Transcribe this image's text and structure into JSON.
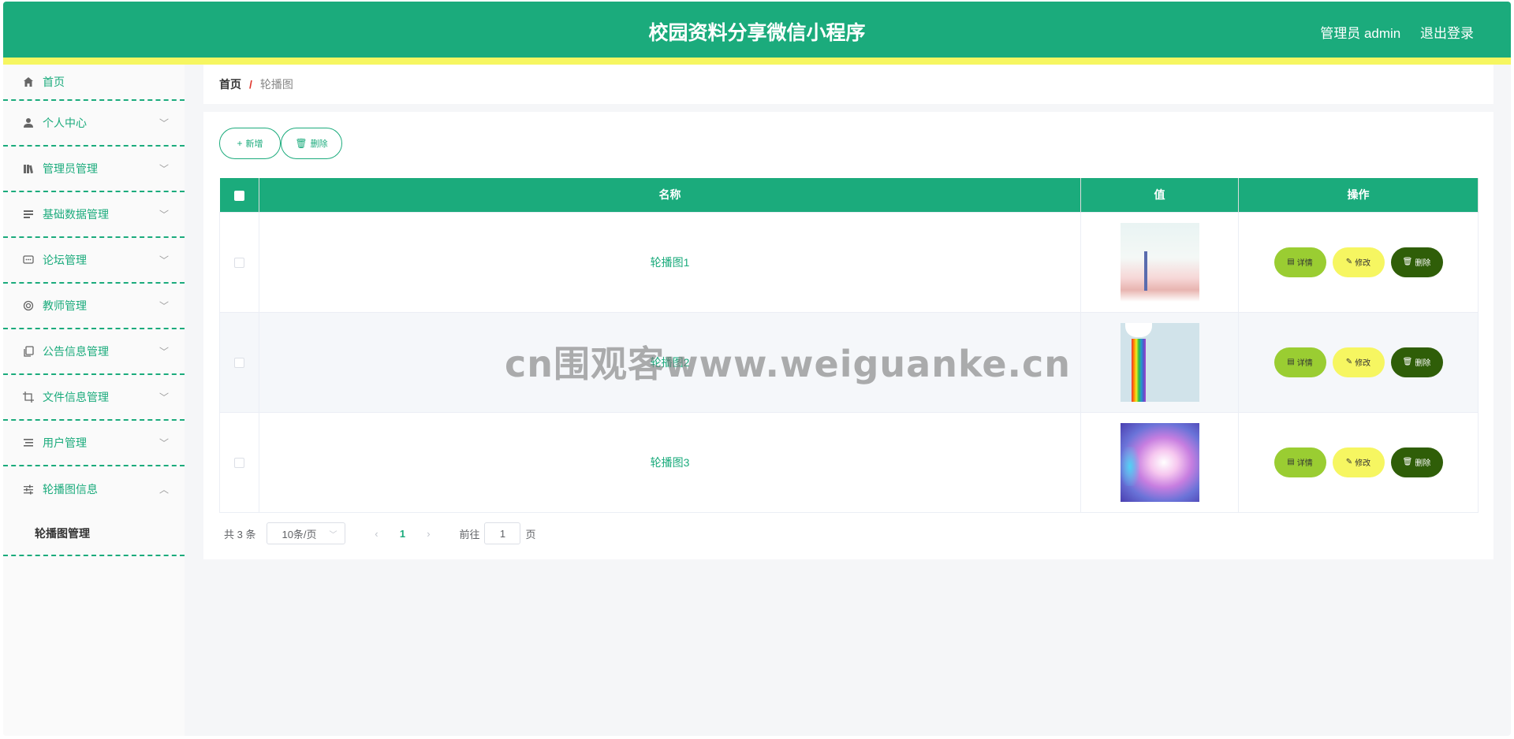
{
  "header": {
    "title": "校园资料分享微信小程序",
    "user_label": "管理员 admin",
    "logout_label": "退出登录"
  },
  "sidebar": {
    "items": [
      {
        "label": "首页",
        "icon": "home-icon"
      },
      {
        "label": "个人中心",
        "icon": "user-icon"
      },
      {
        "label": "管理员管理",
        "icon": "books-icon"
      },
      {
        "label": "基础数据管理",
        "icon": "list-icon"
      },
      {
        "label": "论坛管理",
        "icon": "chat-icon"
      },
      {
        "label": "教师管理",
        "icon": "lifebuoy-icon"
      },
      {
        "label": "公告信息管理",
        "icon": "copy-icon"
      },
      {
        "label": "文件信息管理",
        "icon": "crop-icon"
      },
      {
        "label": "用户管理",
        "icon": "menu-icon"
      },
      {
        "label": "轮播图信息",
        "icon": "sliders-icon"
      }
    ],
    "submenu_label": "轮播图管理"
  },
  "breadcrumb": {
    "home": "首页",
    "separator": "/",
    "current": "轮播图"
  },
  "toolbar": {
    "add_label": "新增",
    "delete_label": "删除"
  },
  "table": {
    "headers": [
      "名称",
      "值",
      "操作"
    ],
    "rows": [
      {
        "name": "轮播图1",
        "image": "illustration-girl-with-fence"
      },
      {
        "name": "轮播图2",
        "image": "rainbow-sky"
      },
      {
        "name": "轮播图3",
        "image": "purple-gradient-glow"
      }
    ],
    "actions": {
      "detail": "详情",
      "edit": "修改",
      "delete": "删除"
    }
  },
  "pagination": {
    "total": "共 3 条",
    "page_size": "10条/页",
    "current_page": "1",
    "goto_prefix": "前往",
    "goto_value": "1",
    "goto_suffix": "页"
  },
  "watermark": "cn围观客www.weiguanke.cn",
  "colors": {
    "primary": "#1bab7c",
    "accent_stripe": "#f6f661",
    "detail_button": "#9acd32",
    "edit_button": "#f6f661",
    "delete_button": "#2f5e08"
  }
}
